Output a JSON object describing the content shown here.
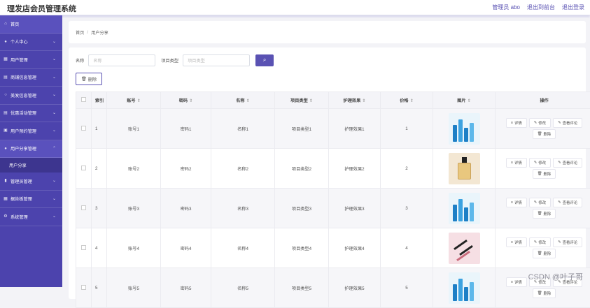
{
  "header": {
    "title": "理发店会员管理系统",
    "links": [
      "管理员 abo",
      "退出到前台",
      "退出登录"
    ]
  },
  "sidebar": {
    "items": [
      {
        "label": "首页",
        "icon": "home-icon",
        "expandable": false
      },
      {
        "label": "个人中心",
        "icon": "user-icon",
        "expandable": true
      },
      {
        "label": "用户管理",
        "icon": "grid-icon",
        "expandable": true
      },
      {
        "label": "商铺信息管理",
        "icon": "shop-icon",
        "expandable": true
      },
      {
        "label": "美发信息管理",
        "icon": "circle-icon",
        "expandable": true
      },
      {
        "label": "优惠活动管理",
        "icon": "list-icon",
        "expandable": true
      },
      {
        "label": "用户预约管理",
        "icon": "calendar-icon",
        "expandable": true
      },
      {
        "label": "用户分享管理",
        "icon": "user-icon",
        "expandable": true,
        "open": true,
        "sub": [
          "用户分享"
        ]
      },
      {
        "label": "管理员管理",
        "icon": "chart-icon",
        "expandable": true
      },
      {
        "label": "据告板管理",
        "icon": "board-icon",
        "expandable": true
      },
      {
        "label": "系统管理",
        "icon": "settings-icon",
        "expandable": true
      }
    ]
  },
  "breadcrumb": [
    "首页",
    "用户分享"
  ],
  "search": {
    "name_label": "名称",
    "name_placeholder": "名称",
    "type_label": "项目类型",
    "type_placeholder": "项目类型"
  },
  "toolbar": {
    "delete_label": "删除"
  },
  "table": {
    "columns": [
      "索引",
      "账号",
      "密码",
      "名称",
      "项目类型",
      "护理效果",
      "价格",
      "图片",
      "操作"
    ],
    "rows": [
      {
        "idx": "1",
        "account": "账号1",
        "password": "密码1",
        "name": "名称1",
        "type": "项目类型1",
        "effect": "护理效果1",
        "price": "1",
        "image": "blue-skincare-products"
      },
      {
        "idx": "2",
        "account": "账号2",
        "password": "密码2",
        "name": "名称2",
        "type": "项目类型2",
        "effect": "护理效果2",
        "price": "2",
        "image": "perfume-bottle"
      },
      {
        "idx": "3",
        "account": "账号3",
        "password": "密码3",
        "name": "名称3",
        "type": "项目类型3",
        "effect": "护理效果3",
        "price": "3",
        "image": "blue-skincare-products"
      },
      {
        "idx": "4",
        "account": "账号4",
        "password": "密码4",
        "name": "名称4",
        "type": "项目类型4",
        "effect": "护理效果4",
        "price": "4",
        "image": "makeup-brushes"
      },
      {
        "idx": "5",
        "account": "账号5",
        "password": "密码5",
        "name": "名称5",
        "type": "项目类型5",
        "effect": "护理效果5",
        "price": "5",
        "image": "blue-skincare-products"
      }
    ],
    "actions": [
      "详情",
      "修改",
      "查看评论",
      "删除"
    ]
  },
  "watermark": "CSDN @叶子哥"
}
